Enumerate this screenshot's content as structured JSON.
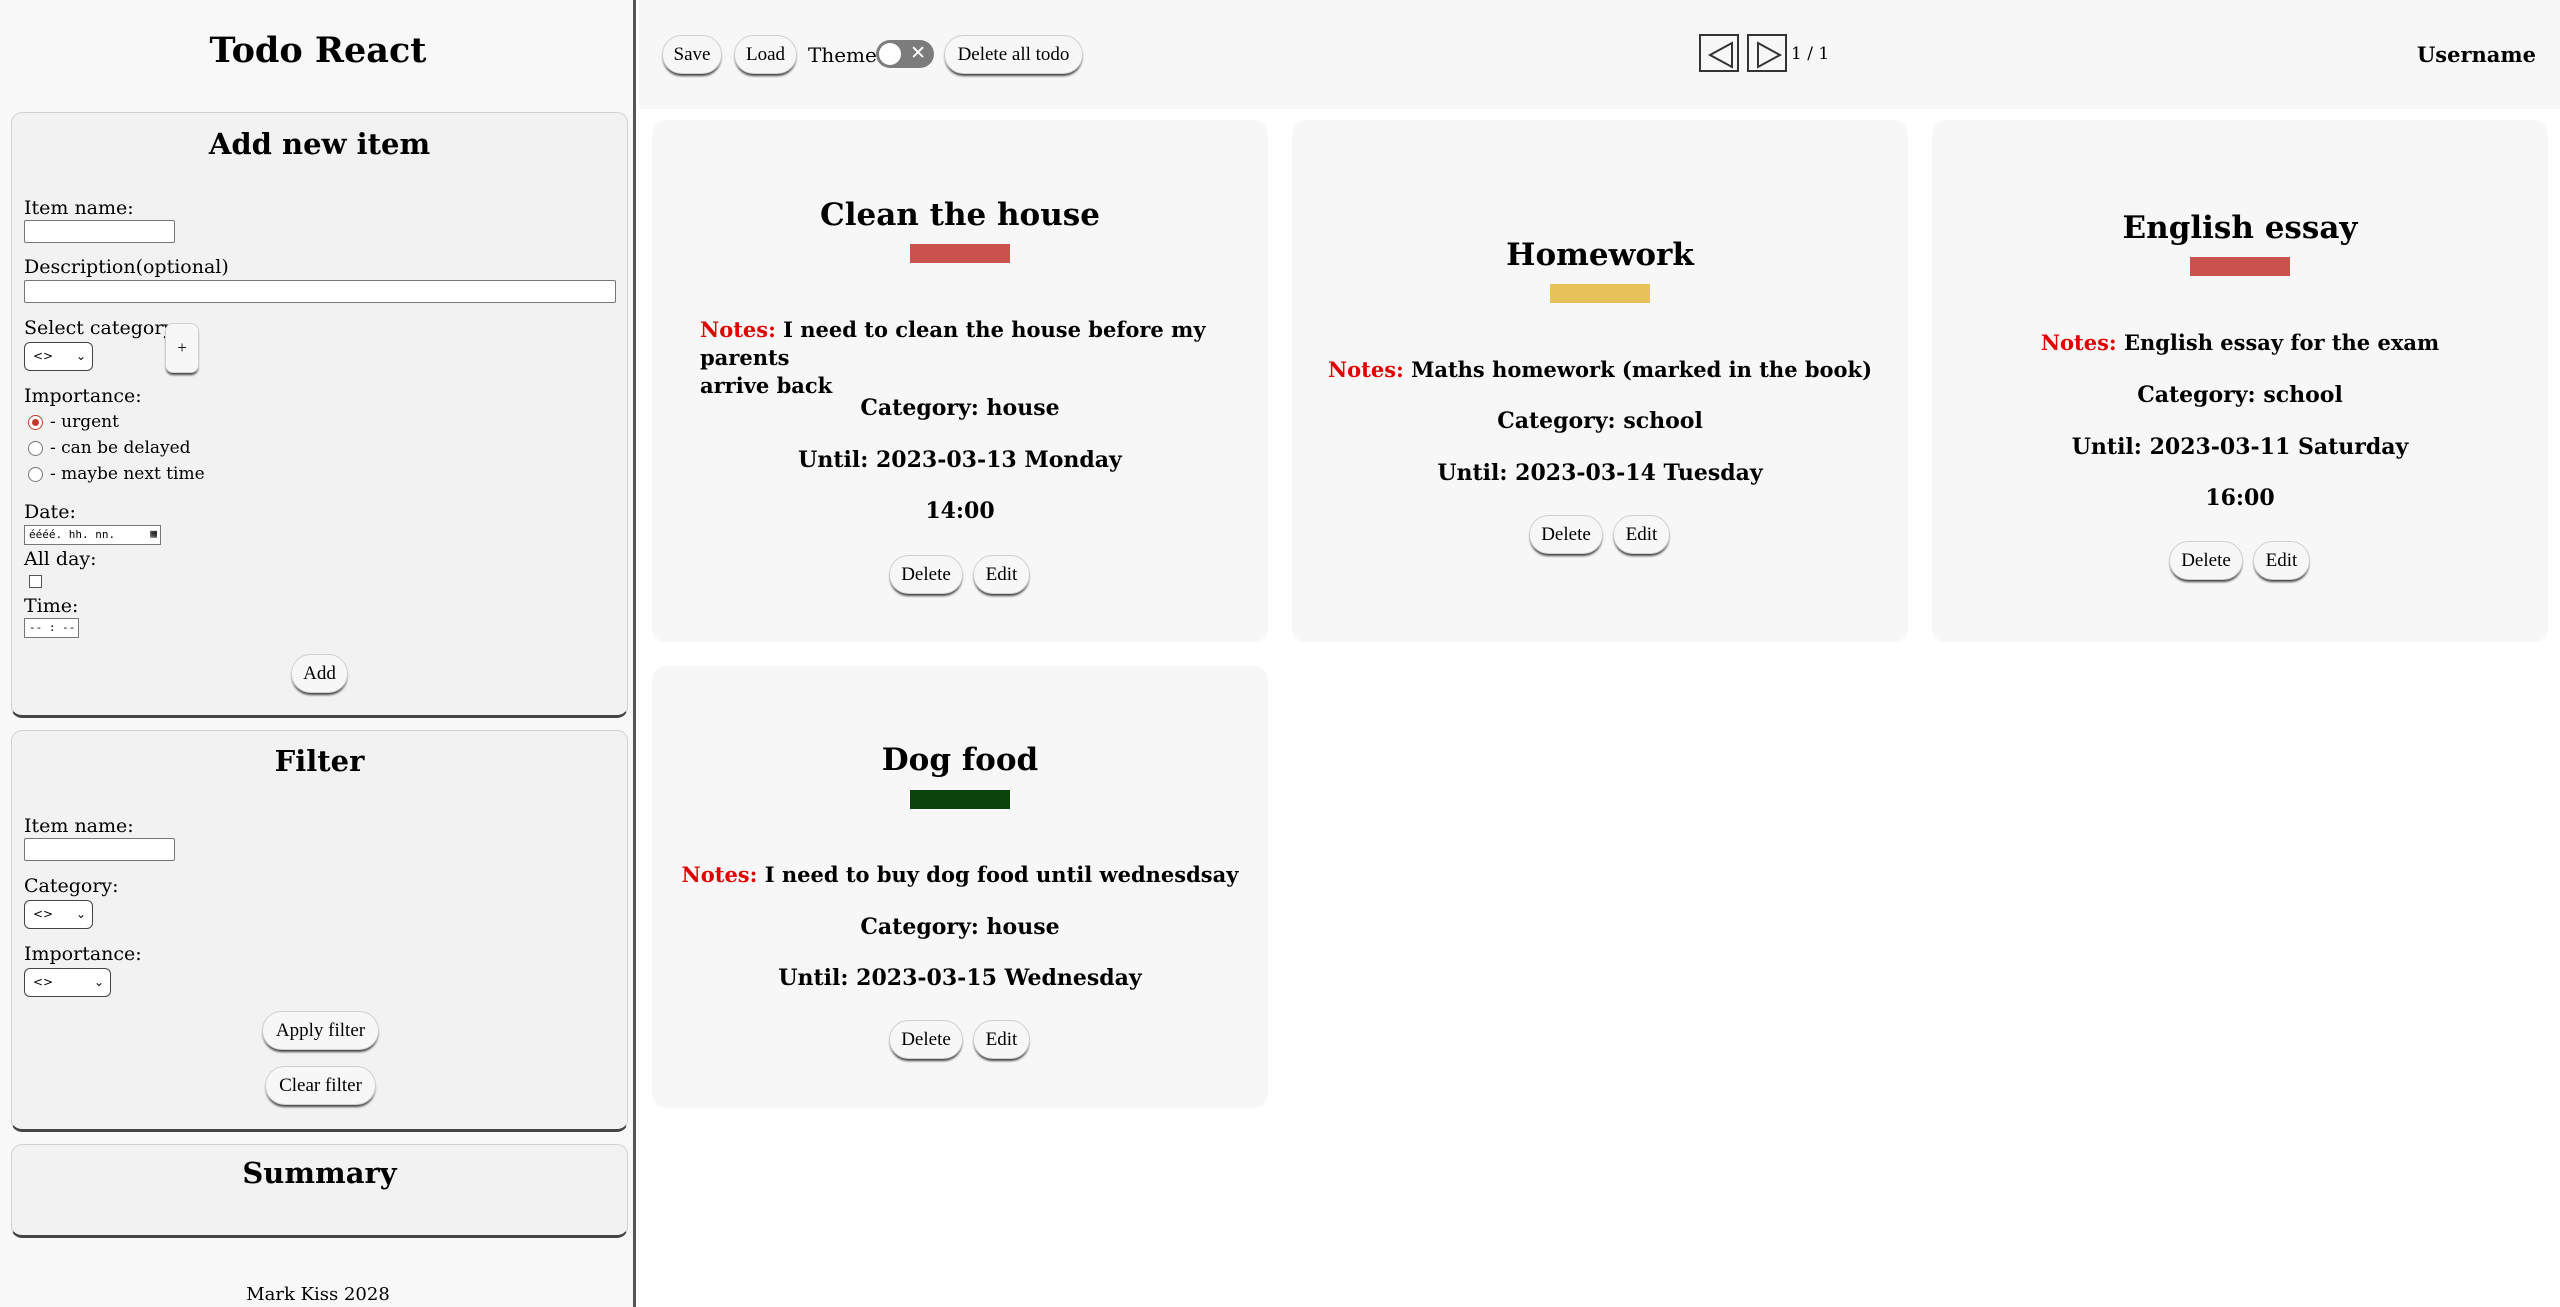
{
  "app": {
    "title": "Todo React",
    "footer": "Mark Kiss 2028"
  },
  "add_panel": {
    "title": "Add new item",
    "item_name_label": "Item name:",
    "description_label": "Description(optional)",
    "select_category_label": "Select category:",
    "category_value": "<>",
    "add_category_label": "+",
    "importance_label": "Importance:",
    "importance_options": [
      "- urgent",
      "- can be delayed",
      "- maybe next time"
    ],
    "importance_selected": "- urgent",
    "date_label": "Date:",
    "date_placeholder": "éééé. hh. nn.",
    "allday_label": "All day:",
    "time_label": "Time:",
    "time_placeholder": "-- : --",
    "add_button": "Add"
  },
  "filter_panel": {
    "title": "Filter",
    "item_name_label": "Item name:",
    "category_label": "Category:",
    "category_value": "<>",
    "importance_label": "Importance:",
    "importance_value": "<>",
    "apply_button": "Apply filter",
    "clear_button": "Clear filter"
  },
  "summary_panel": {
    "title": "Summary"
  },
  "topbar": {
    "save": "Save",
    "load": "Load",
    "theme_label": "Theme:",
    "delete_all": "Delete all todo",
    "page_indicator": "1 / 1",
    "username": "Username"
  },
  "colors": {
    "red": "#c9524f",
    "yellow": "#e7c25a",
    "green": "#0b430c",
    "notes": "#e00000"
  },
  "cards": [
    {
      "title": "Clean the house",
      "color": "#c9524f",
      "notes_label": "Notes:",
      "notes_line1": "I need to clean the house before my parents",
      "notes_line2": "arrive back",
      "category": "Category: house",
      "until": "Until: 2023-03-13 Monday",
      "time": "14:00",
      "delete": "Delete",
      "edit": "Edit"
    },
    {
      "title": "Homework",
      "color": "#e7c25a",
      "notes_label": "Notes:",
      "notes": "Maths homework (marked in the book)",
      "category": "Category: school",
      "until": "Until: 2023-03-14 Tuesday",
      "delete": "Delete",
      "edit": "Edit"
    },
    {
      "title": "English essay",
      "color": "#c9524f",
      "notes_label": "Notes:",
      "notes": "English essay for the exam",
      "category": "Category: school",
      "until": "Until: 2023-03-11 Saturday",
      "time": "16:00",
      "delete": "Delete",
      "edit": "Edit"
    },
    {
      "title": "Dog food",
      "color": "#0b430c",
      "notes_label": "Notes:",
      "notes": "I need to buy dog food until wednesdsay",
      "category": "Category: house",
      "until": "Until: 2023-03-15 Wednesday",
      "delete": "Delete",
      "edit": "Edit"
    }
  ]
}
